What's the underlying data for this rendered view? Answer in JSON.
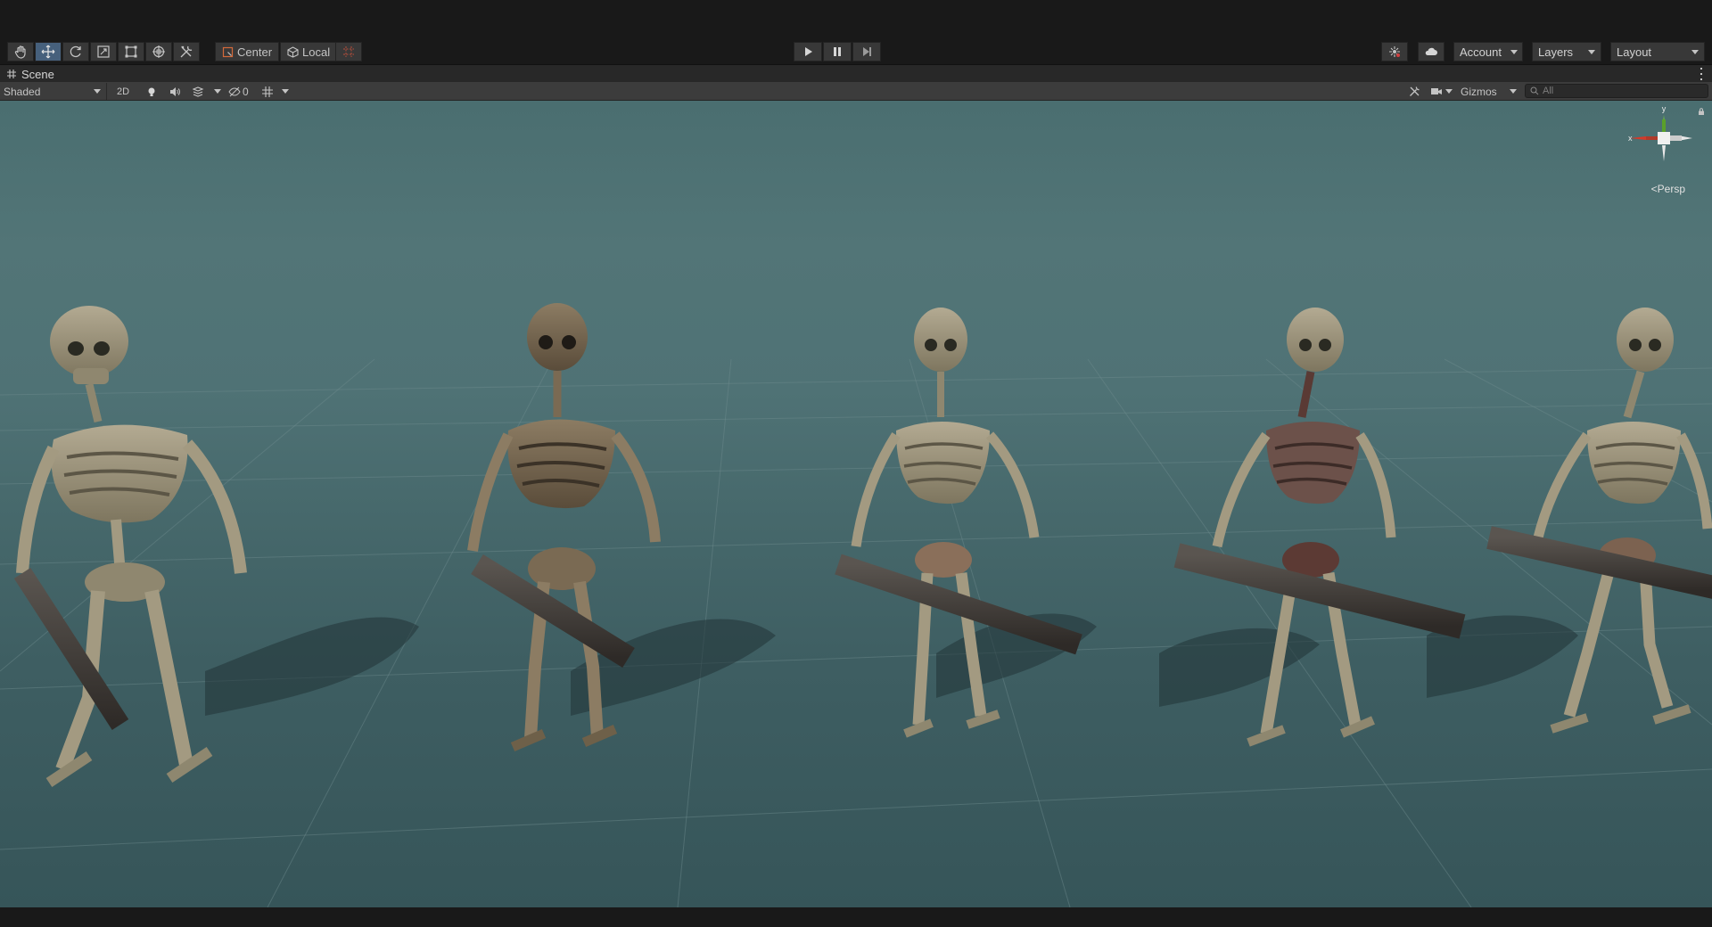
{
  "toolbar": {
    "tools": [
      {
        "name": "hand-tool",
        "icon": "hand-icon",
        "active": false
      },
      {
        "name": "move-tool",
        "icon": "move-icon",
        "active": true
      },
      {
        "name": "rotate-tool",
        "icon": "rotate-icon",
        "active": false
      },
      {
        "name": "scale-tool",
        "icon": "scale-icon",
        "active": false
      },
      {
        "name": "rect-tool",
        "icon": "rect-icon",
        "active": false
      },
      {
        "name": "transform-tool",
        "icon": "transform-icon",
        "active": false
      },
      {
        "name": "custom-tool",
        "icon": "tools-icon",
        "active": false
      }
    ],
    "pivot_label": "Center",
    "space_label": "Local",
    "play_controls": [
      "play-icon",
      "pause-icon",
      "step-icon"
    ],
    "account_label": "Account",
    "layers_label": "Layers",
    "layout_label": "Layout"
  },
  "scene": {
    "tab_label": "Scene",
    "shading_mode": "Shaded",
    "mode_2d_label": "2D",
    "hidden_count": "0",
    "gizmos_label": "Gizmos",
    "search_placeholder": "All",
    "persp_label": "Persp",
    "axis_x": "x",
    "axis_y": "y"
  },
  "colors": {
    "accent_active": "#46607c",
    "sky": "#527577",
    "ground": "#3e5e62",
    "bone": "#a89e86"
  }
}
